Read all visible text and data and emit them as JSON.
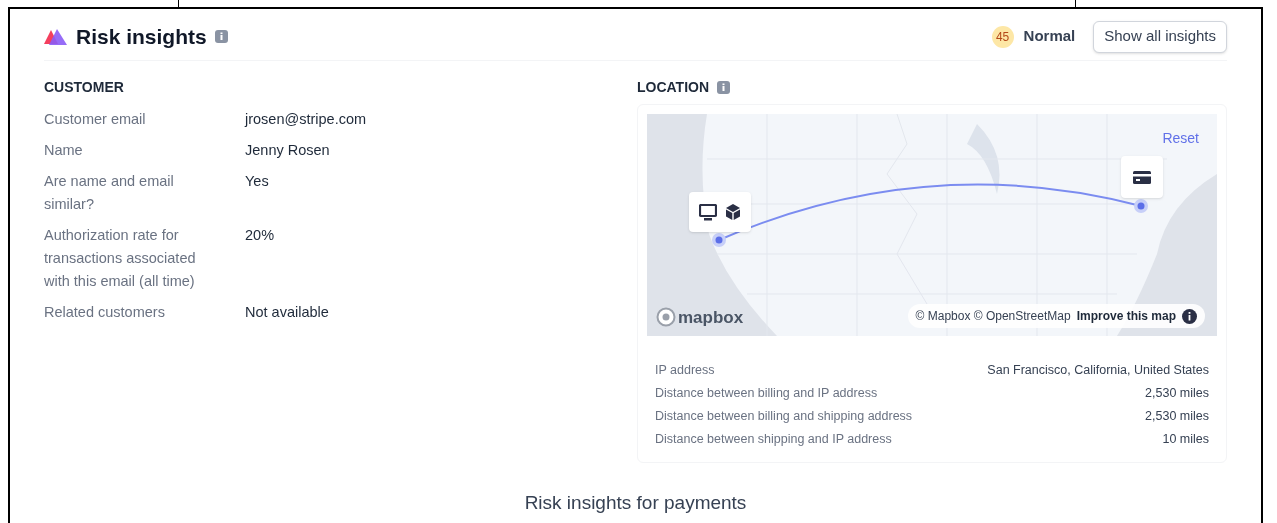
{
  "header": {
    "title": "Risk insights",
    "score": "45",
    "risk_level": "Normal",
    "button": "Show all insights"
  },
  "customer": {
    "heading": "CUSTOMER",
    "rows": [
      {
        "label": "Customer email",
        "value": "jrosen@stripe.com"
      },
      {
        "label": "Name",
        "value": "Jenny Rosen"
      },
      {
        "label": "Are name and email similar?",
        "value": "Yes"
      },
      {
        "label": "Authorization rate for transactions associated with this email (all time)",
        "value": "20%"
      },
      {
        "label": "Related customers",
        "value": "Not available"
      }
    ]
  },
  "location": {
    "heading": "LOCATION",
    "map": {
      "reset": "Reset",
      "logo": "mapbox",
      "attribution": "© Mapbox © OpenStreetMap",
      "improve_link": "Improve this map"
    },
    "details": [
      {
        "label": "IP address",
        "value": "San Francisco, California, United States"
      },
      {
        "label": "Distance between billing and IP address",
        "value": "2,530 miles"
      },
      {
        "label": "Distance between billing and shipping address",
        "value": "2,530 miles"
      },
      {
        "label": "Distance between shipping and IP address",
        "value": "10 miles"
      }
    ]
  },
  "caption": "Risk insights for payments"
}
